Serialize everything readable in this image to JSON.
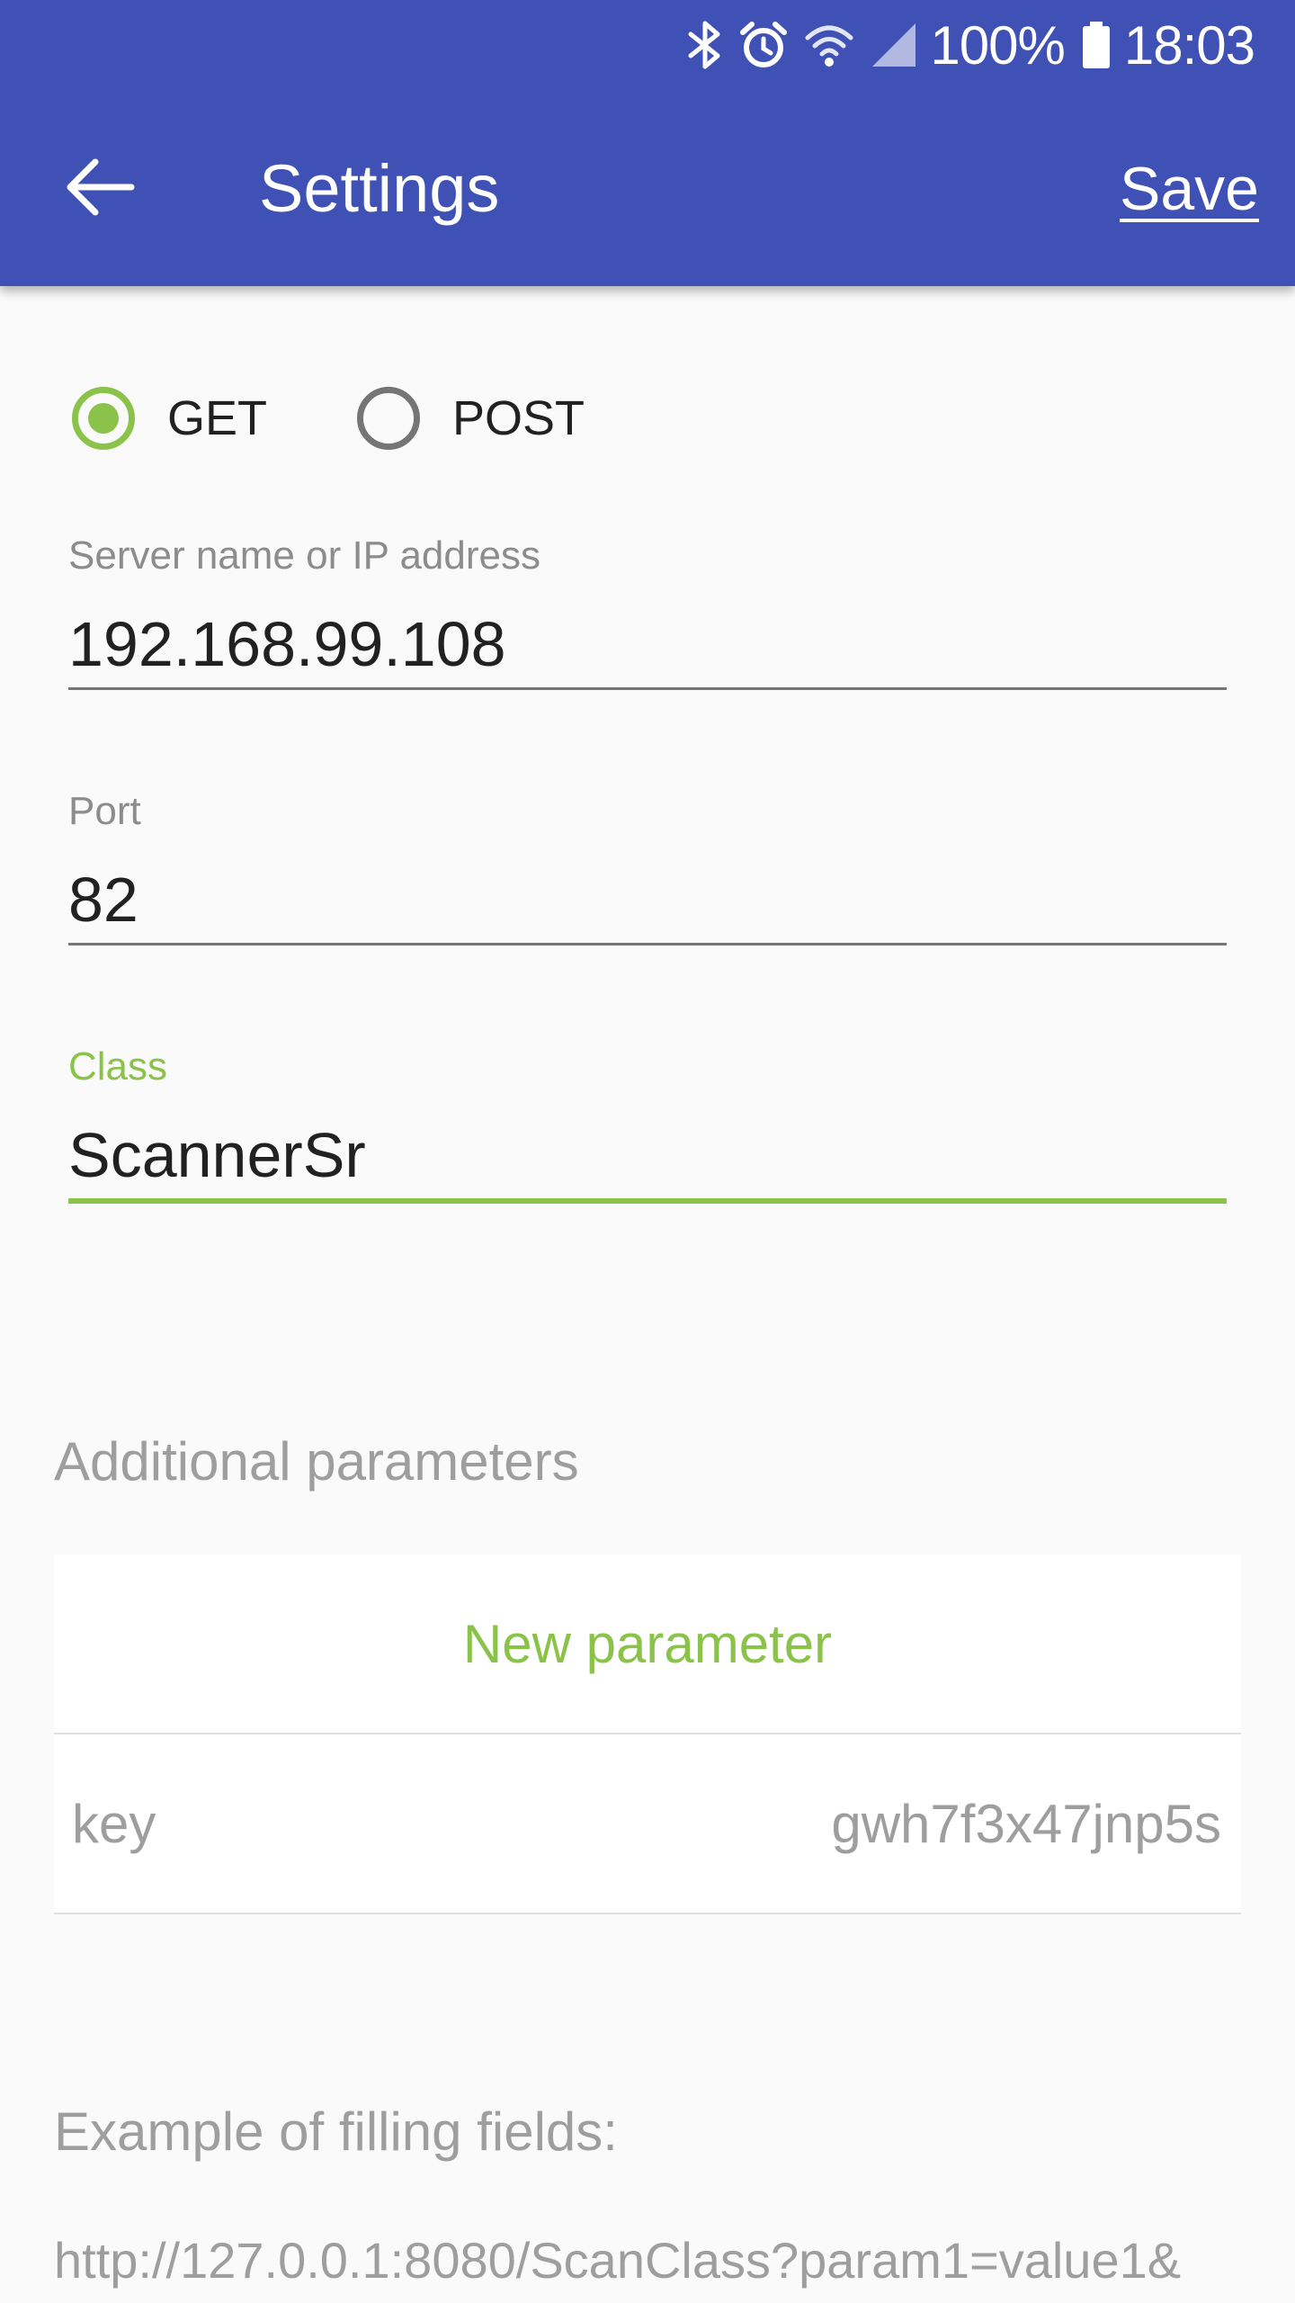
{
  "status_bar": {
    "battery": "100%",
    "time": "18:03",
    "icons": [
      "bluetooth-icon",
      "alarm-icon",
      "wifi-icon",
      "signal-icon",
      "battery-icon"
    ]
  },
  "appbar": {
    "title": "Settings",
    "save_label": "Save",
    "back_icon": "arrow-back-icon"
  },
  "method": {
    "options": [
      {
        "label": "GET",
        "checked": true
      },
      {
        "label": "POST",
        "checked": false
      }
    ]
  },
  "fields": {
    "server": {
      "label": "Server name or IP address",
      "value": "192.168.99.108"
    },
    "port": {
      "label": "Port",
      "value": "82"
    },
    "class": {
      "label": "Class",
      "value": "ScannerSr"
    }
  },
  "params": {
    "heading": "Additional parameters",
    "new_label": "New parameter",
    "items": [
      {
        "key": "key",
        "value": "gwh7f3x47jnp5s"
      }
    ]
  },
  "example": {
    "heading": "Example of filling fields:",
    "url": "http://127.0.0.1:8080/ScanClass?param1=value1&"
  },
  "colors": {
    "primary": "#3f51b5",
    "accent": "#8bc34a",
    "background": "#fafafa"
  }
}
